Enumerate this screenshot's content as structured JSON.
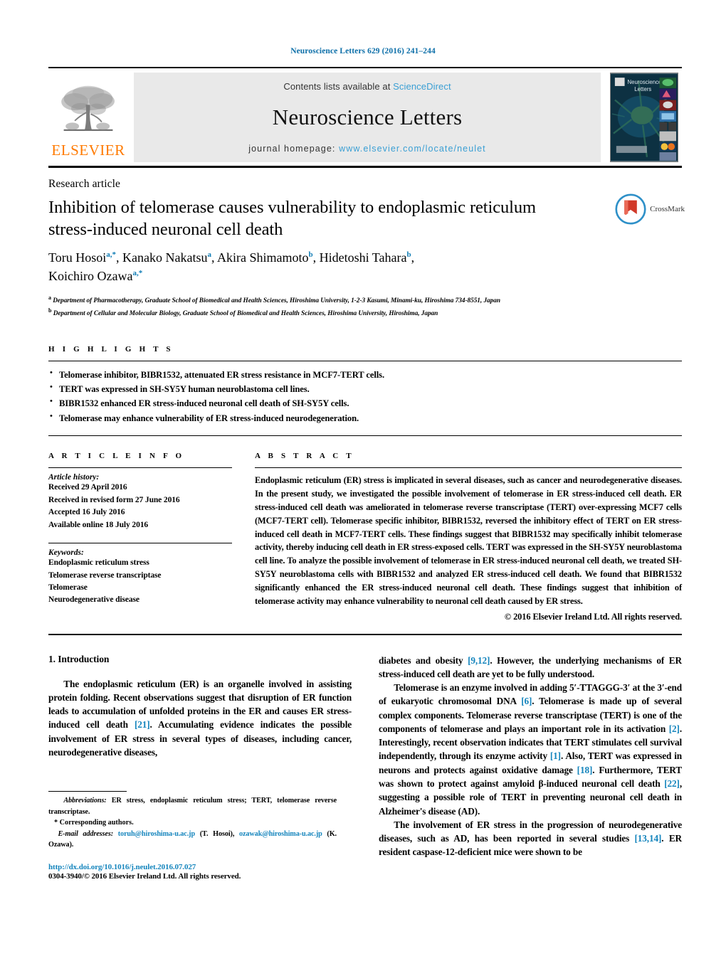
{
  "journal_ref": "Neuroscience Letters 629 (2016) 241–244",
  "masthead": {
    "publisher_name": "ELSEVIER",
    "contents_prefix": "Contents lists available at ",
    "contents_link": "ScienceDirect",
    "journal_title": "Neuroscience Letters",
    "homepage_prefix": "journal homepage: ",
    "homepage_url": "www.elsevier.com/locate/neulet",
    "cover_title_line1": "Neuroscience",
    "cover_title_line2": "Letters"
  },
  "article": {
    "type_label": "Research article",
    "title": "Inhibition of telomerase causes vulnerability to endoplasmic reticulum stress-induced neuronal cell death",
    "authors_line1": "Toru Hosoi",
    "authors_line1_sup": "a,*",
    "authors_part2": ", Kanako Nakatsu",
    "authors_part2_sup": "a",
    "authors_part3": ", Akira Shimamoto",
    "authors_part3_sup": "b",
    "authors_part4": ", Hidetoshi Tahara",
    "authors_part4_sup": "b",
    "authors_part5": ",",
    "authors_line2": "Koichiro Ozawa",
    "authors_line2_sup": "a,*",
    "affiliation_a_sup": "a",
    "affiliation_a": "Department of Pharmacotherapy, Graduate School of Biomedical and Health Sciences, Hiroshima University, 1-2-3 Kasumi, Minami-ku, Hiroshima 734-8551, Japan",
    "affiliation_b_sup": "b",
    "affiliation_b": "Department of Cellular and Molecular Biology, Graduate School of Biomedical and Health Sciences, Hiroshima University, Hiroshima, Japan",
    "crossmark_label": "CrossMark"
  },
  "highlights": {
    "label": "H I G H L I G H T S",
    "items": [
      "Telomerase inhibitor, BIBR1532, attenuated ER stress resistance in MCF7-TERT cells.",
      "TERT was expressed in SH-SY5Y human neuroblastoma cell lines.",
      "BIBR1532 enhanced ER stress-induced neuronal cell death of SH-SY5Y cells.",
      "Telomerase may enhance vulnerability of ER stress-induced neurodegeneration."
    ]
  },
  "article_info": {
    "label": "A R T I C L E    I N F O",
    "history_label": "Article history:",
    "history": [
      "Received 29 April 2016",
      "Received in revised form 27 June 2016",
      "Accepted 16 July 2016",
      "Available online 18 July 2016"
    ],
    "keywords_label": "Keywords:",
    "keywords": [
      "Endoplasmic reticulum stress",
      "Telomerase reverse transcriptase",
      "Telomerase",
      "Neurodegenerative disease"
    ]
  },
  "abstract": {
    "label": "A B S T R A C T",
    "body": "Endoplasmic reticulum (ER) stress is implicated in several diseases, such as cancer and neurodegenerative diseases. In the present study, we investigated the possible involvement of telomerase in ER stress-induced cell death. ER stress-induced cell death was ameliorated in telomerase reverse transcriptase (TERT) over-expressing MCF7 cells (MCF7-TERT cell). Telomerase specific inhibitor, BIBR1532, reversed the inhibitory effect of TERT on ER stress-induced cell death in MCF7-TERT cells. These findings suggest that BIBR1532 may specifically inhibit telomerase activity, thereby inducing cell death in ER stress-exposed cells. TERT was expressed in the SH-SY5Y neuroblastoma cell line. To analyze the possible involvement of telomerase in ER stress-induced neuronal cell death, we treated SH-SY5Y neuroblastoma cells with BIBR1532 and analyzed ER stress-induced cell death. We found that BIBR1532 significantly enhanced the ER stress-induced neuronal cell death. These findings suggest that inhibition of telomerase activity may enhance vulnerability to neuronal cell death caused by ER stress.",
    "copyright": "© 2016 Elsevier Ireland Ltd. All rights reserved."
  },
  "body": {
    "section_number_title": "1.  Introduction",
    "left_paragraph": {
      "p1_a": "The endoplasmic reticulum (ER) is an organelle involved in assisting protein folding. Recent observations suggest that disruption of ER function leads to accumulation of unfolded proteins in the ER and causes ER stress-induced cell death ",
      "p1_ref": "[21]",
      "p1_b": ". Accumulating evidence indicates the possible involvement of ER stress in several types of diseases, including cancer, neurodegenerative diseases,"
    },
    "right_paragraphs": {
      "r1_a": "diabetes and obesity ",
      "r1_ref": "[9,12]",
      "r1_b": ". However, the underlying mechanisms of ER stress-induced cell death are yet to be fully understood.",
      "r2_a": "Telomerase is an enzyme involved in adding 5′-TTAGGG-3′ at the 3′-end of eukaryotic chromosomal DNA ",
      "r2_ref1": "[6]",
      "r2_b": ". Telomerase is made up of several complex components. Telomerase reverse transcriptase (TERT) is one of the components of telomerase and plays an important role in its activation ",
      "r2_ref2": "[2]",
      "r2_c": ". Interestingly, recent observation indicates that TERT stimulates cell survival independently, through its enzyme activity ",
      "r2_ref3": "[1]",
      "r2_d": ". Also, TERT was expressed in neurons and protects against oxidative damage ",
      "r2_ref4": "[18]",
      "r2_e": ". Furthermore, TERT was shown to protect against amyloid β-induced neuronal cell death ",
      "r2_ref5": "[22]",
      "r2_f": ", suggesting a possible role of TERT in preventing neuronal cell death in Alzheimer's disease (AD).",
      "r3_a": "The involvement of ER stress in the progression of neurodegenerative diseases, such as AD, has been reported in several studies ",
      "r3_ref": "[13,14]",
      "r3_b": ". ER resident caspase-12-deficient mice were shown to be"
    }
  },
  "footnotes": {
    "abbrev_label": "Abbreviations:",
    "abbrev_text": "  ER stress, endoplasmic reticulum stress; TERT, telomerase reverse transcriptase.",
    "corresponding": "* Corresponding authors.",
    "email_label": "E-mail addresses:",
    "email1": "toruh@hiroshima-u.ac.jp",
    "email1_owner": " (T. Hosoi),",
    "email2": "ozawak@hiroshima-u.ac.jp",
    "email2_owner": " (K. Ozawa).",
    "doi": "http://dx.doi.org/10.1016/j.neulet.2016.07.027",
    "issn": "0304-3940/© 2016 Elsevier Ireland Ltd. All rights reserved."
  },
  "colors": {
    "link_blue": "#1585bd",
    "masthead_blue": "#3a9fd4",
    "elsevier_orange": "#ff7a00",
    "masthead_bg": "#e9e9e9"
  }
}
